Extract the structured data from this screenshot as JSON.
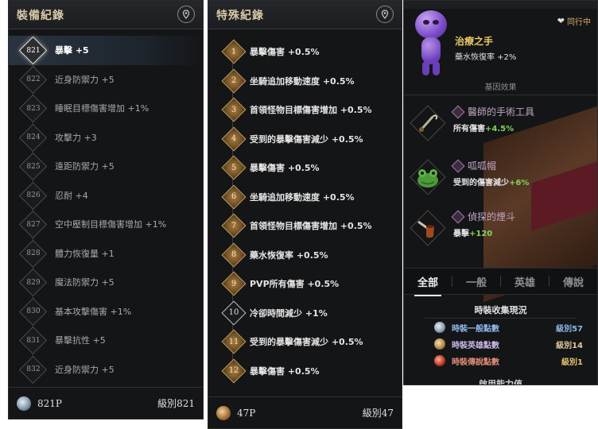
{
  "equipment": {
    "title": "裝備紀錄",
    "items": [
      {
        "num": "821",
        "label": "暴擊 +5",
        "active": true
      },
      {
        "num": "822",
        "label": "近身防禦力 +5"
      },
      {
        "num": "823",
        "label": "睡眠目標傷害增加 +1%"
      },
      {
        "num": "824",
        "label": "攻擊力 +3"
      },
      {
        "num": "825",
        "label": "遠距防禦力 +5"
      },
      {
        "num": "826",
        "label": "忍耐 +4"
      },
      {
        "num": "827",
        "label": "空中壓制目標傷害增加 +1%"
      },
      {
        "num": "828",
        "label": "體力恢復量 +1"
      },
      {
        "num": "829",
        "label": "魔法防禦力 +5"
      },
      {
        "num": "830",
        "label": "基本攻擊傷害 +1%"
      },
      {
        "num": "831",
        "label": "暴擊抗性 +5"
      },
      {
        "num": "832",
        "label": "近身防禦力 +5"
      }
    ],
    "points": "821P",
    "level": "級別821"
  },
  "special": {
    "title": "特殊紀錄",
    "items": [
      {
        "num": "1",
        "label": "暴擊傷害 +0.5%"
      },
      {
        "num": "2",
        "label": "坐騎追加移動速度 +0.5%"
      },
      {
        "num": "3",
        "label": "首領怪物目標傷害增加 +0.5%"
      },
      {
        "num": "4",
        "label": "受到的暴擊傷害減少 +0.5%"
      },
      {
        "num": "5",
        "label": "暴擊傷害 +0.5%"
      },
      {
        "num": "6",
        "label": "坐騎追加移動速度 +0.5%"
      },
      {
        "num": "7",
        "label": "首領怪物目標傷害增加 +0.5%"
      },
      {
        "num": "8",
        "label": "藥水恢復率 +0.5%"
      },
      {
        "num": "9",
        "label": "PVP所有傷害 +0.5%"
      },
      {
        "num": "10",
        "label": "冷卻時間減少 +1%",
        "grey": true
      },
      {
        "num": "11",
        "label": "受到的暴擊傷害減少 +0.5%"
      },
      {
        "num": "12",
        "label": "暴擊傷害 +0.5%"
      }
    ],
    "points": "47P",
    "level": "級別47"
  },
  "costume": {
    "companion_name": "治療之手",
    "companion_effect": "藥水恢復率 +2%",
    "accompany_label": "同行中",
    "section_label": "基因效果",
    "items": [
      {
        "name": "醫師的手術工具",
        "stat_label": "所有傷害",
        "stat_value": "+4.5%"
      },
      {
        "name": "呱呱帽",
        "stat_label": "受到的傷害減少",
        "stat_value": "+6%"
      },
      {
        "name": "偵探的煙斗",
        "stat_label": "暴擊",
        "stat_value": "+120"
      }
    ],
    "tabs": [
      "全部",
      "一般",
      "英雄",
      "傳說"
    ],
    "collection_title": "時裝收集現況",
    "collection": [
      {
        "label": "時裝一般點數",
        "value": "級別57"
      },
      {
        "label": "時裝英雄點數",
        "value": "級別14"
      },
      {
        "label": "時裝傳說點數",
        "value": "級別1"
      }
    ],
    "cut_text": "啟用能力值"
  }
}
